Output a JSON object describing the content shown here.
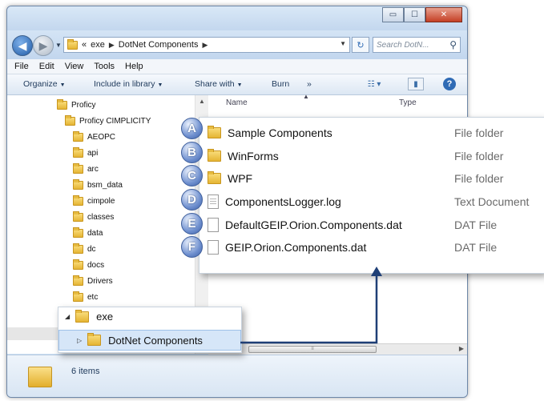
{
  "titlebar": {
    "buttons": {
      "minimize": "▭",
      "maximize": "☐",
      "close": "✕"
    }
  },
  "address": {
    "overflow": "«",
    "crumbs": [
      "exe",
      "DotNet Components"
    ],
    "search_placeholder": "Search DotN..."
  },
  "menu": [
    "File",
    "Edit",
    "View",
    "Tools",
    "Help"
  ],
  "toolbar": {
    "organize": "Organize",
    "include": "Include in library",
    "share": "Share with",
    "burn": "Burn",
    "more": "»"
  },
  "nav_tree": {
    "root": "Proficy",
    "child": "Proficy CIMPLICITY",
    "folders": [
      "AEOPC",
      "api",
      "arc",
      "bsm_data",
      "cimpole",
      "classes",
      "data",
      "dc",
      "docs",
      "Drivers",
      "etc"
    ]
  },
  "columns": {
    "name": "Name",
    "type": "Type"
  },
  "callout_files": [
    {
      "badge": "A",
      "name": "Sample Components",
      "type": "File folder",
      "icon": "folder-icon"
    },
    {
      "badge": "B",
      "name": "WinForms",
      "type": "File folder",
      "icon": "folder-icon"
    },
    {
      "badge": "C",
      "name": "WPF",
      "type": "File folder",
      "icon": "folder-icon"
    },
    {
      "badge": "D",
      "name": "ComponentsLogger.log",
      "type": "Text Document",
      "icon": "text-document-icon"
    },
    {
      "badge": "E",
      "name": "DefaultGEIP.Orion.Components.dat",
      "type": "DAT File",
      "icon": "file-icon"
    },
    {
      "badge": "F",
      "name": "GEIP.Orion.Components.dat",
      "type": "DAT File",
      "icon": "file-icon"
    }
  ],
  "callout_tree": {
    "parent": "exe",
    "selected": "DotNet Components"
  },
  "status": {
    "count": "6 items"
  },
  "colors": {
    "arrow": "#1f3f76",
    "selection": "#d6e6f8"
  }
}
